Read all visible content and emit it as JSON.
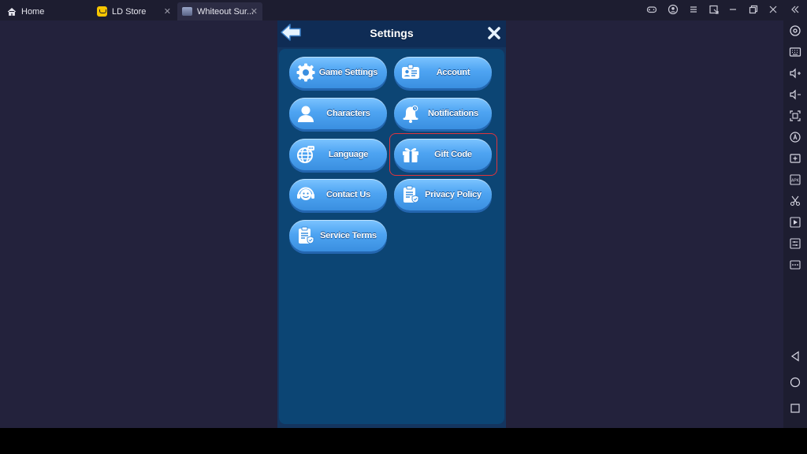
{
  "tabs": [
    {
      "label": "Home",
      "icon": "home-icon"
    },
    {
      "label": "LD Store",
      "icon": "ld-store-icon"
    },
    {
      "label": "Whiteout Sur...",
      "icon": "game-thumbnail-icon"
    }
  ],
  "window_controls": [
    "gamepad-icon",
    "account-icon",
    "menu-icon",
    "popout-icon",
    "minimize-icon",
    "restore-icon",
    "close-icon",
    "collapse-sidebar-icon"
  ],
  "settings": {
    "title": "Settings",
    "buttons": [
      {
        "label": "Game Settings",
        "icon": "gear-icon"
      },
      {
        "label": "Account",
        "icon": "id-card-icon"
      },
      {
        "label": "Characters",
        "icon": "person-icon"
      },
      {
        "label": "Notifications",
        "icon": "bell-icon"
      },
      {
        "label": "Language",
        "icon": "globe-icon"
      },
      {
        "label": "Gift Code",
        "icon": "gift-icon"
      },
      {
        "label": "Contact Us",
        "icon": "headset-icon"
      },
      {
        "label": "Privacy Policy",
        "icon": "clipboard-shield-icon"
      },
      {
        "label": "Service Terms",
        "icon": "clipboard-shield-icon"
      }
    ],
    "highlighted": "Gift Code"
  },
  "right_toolbar": [
    "settings-icon",
    "keyboard-icon",
    "volume-up-icon",
    "volume-down-icon",
    "screenshot-icon",
    "sync-icon",
    "add-icon",
    "apk-icon",
    "scissors-icon",
    "record-icon",
    "operation-icon",
    "more-icon",
    "back-nav-icon",
    "home-nav-icon",
    "recent-apps-icon"
  ],
  "colors": {
    "panel": "#14355f",
    "button": "#4ea4f2",
    "highlight": "#e0343c",
    "background": "#23223c"
  }
}
